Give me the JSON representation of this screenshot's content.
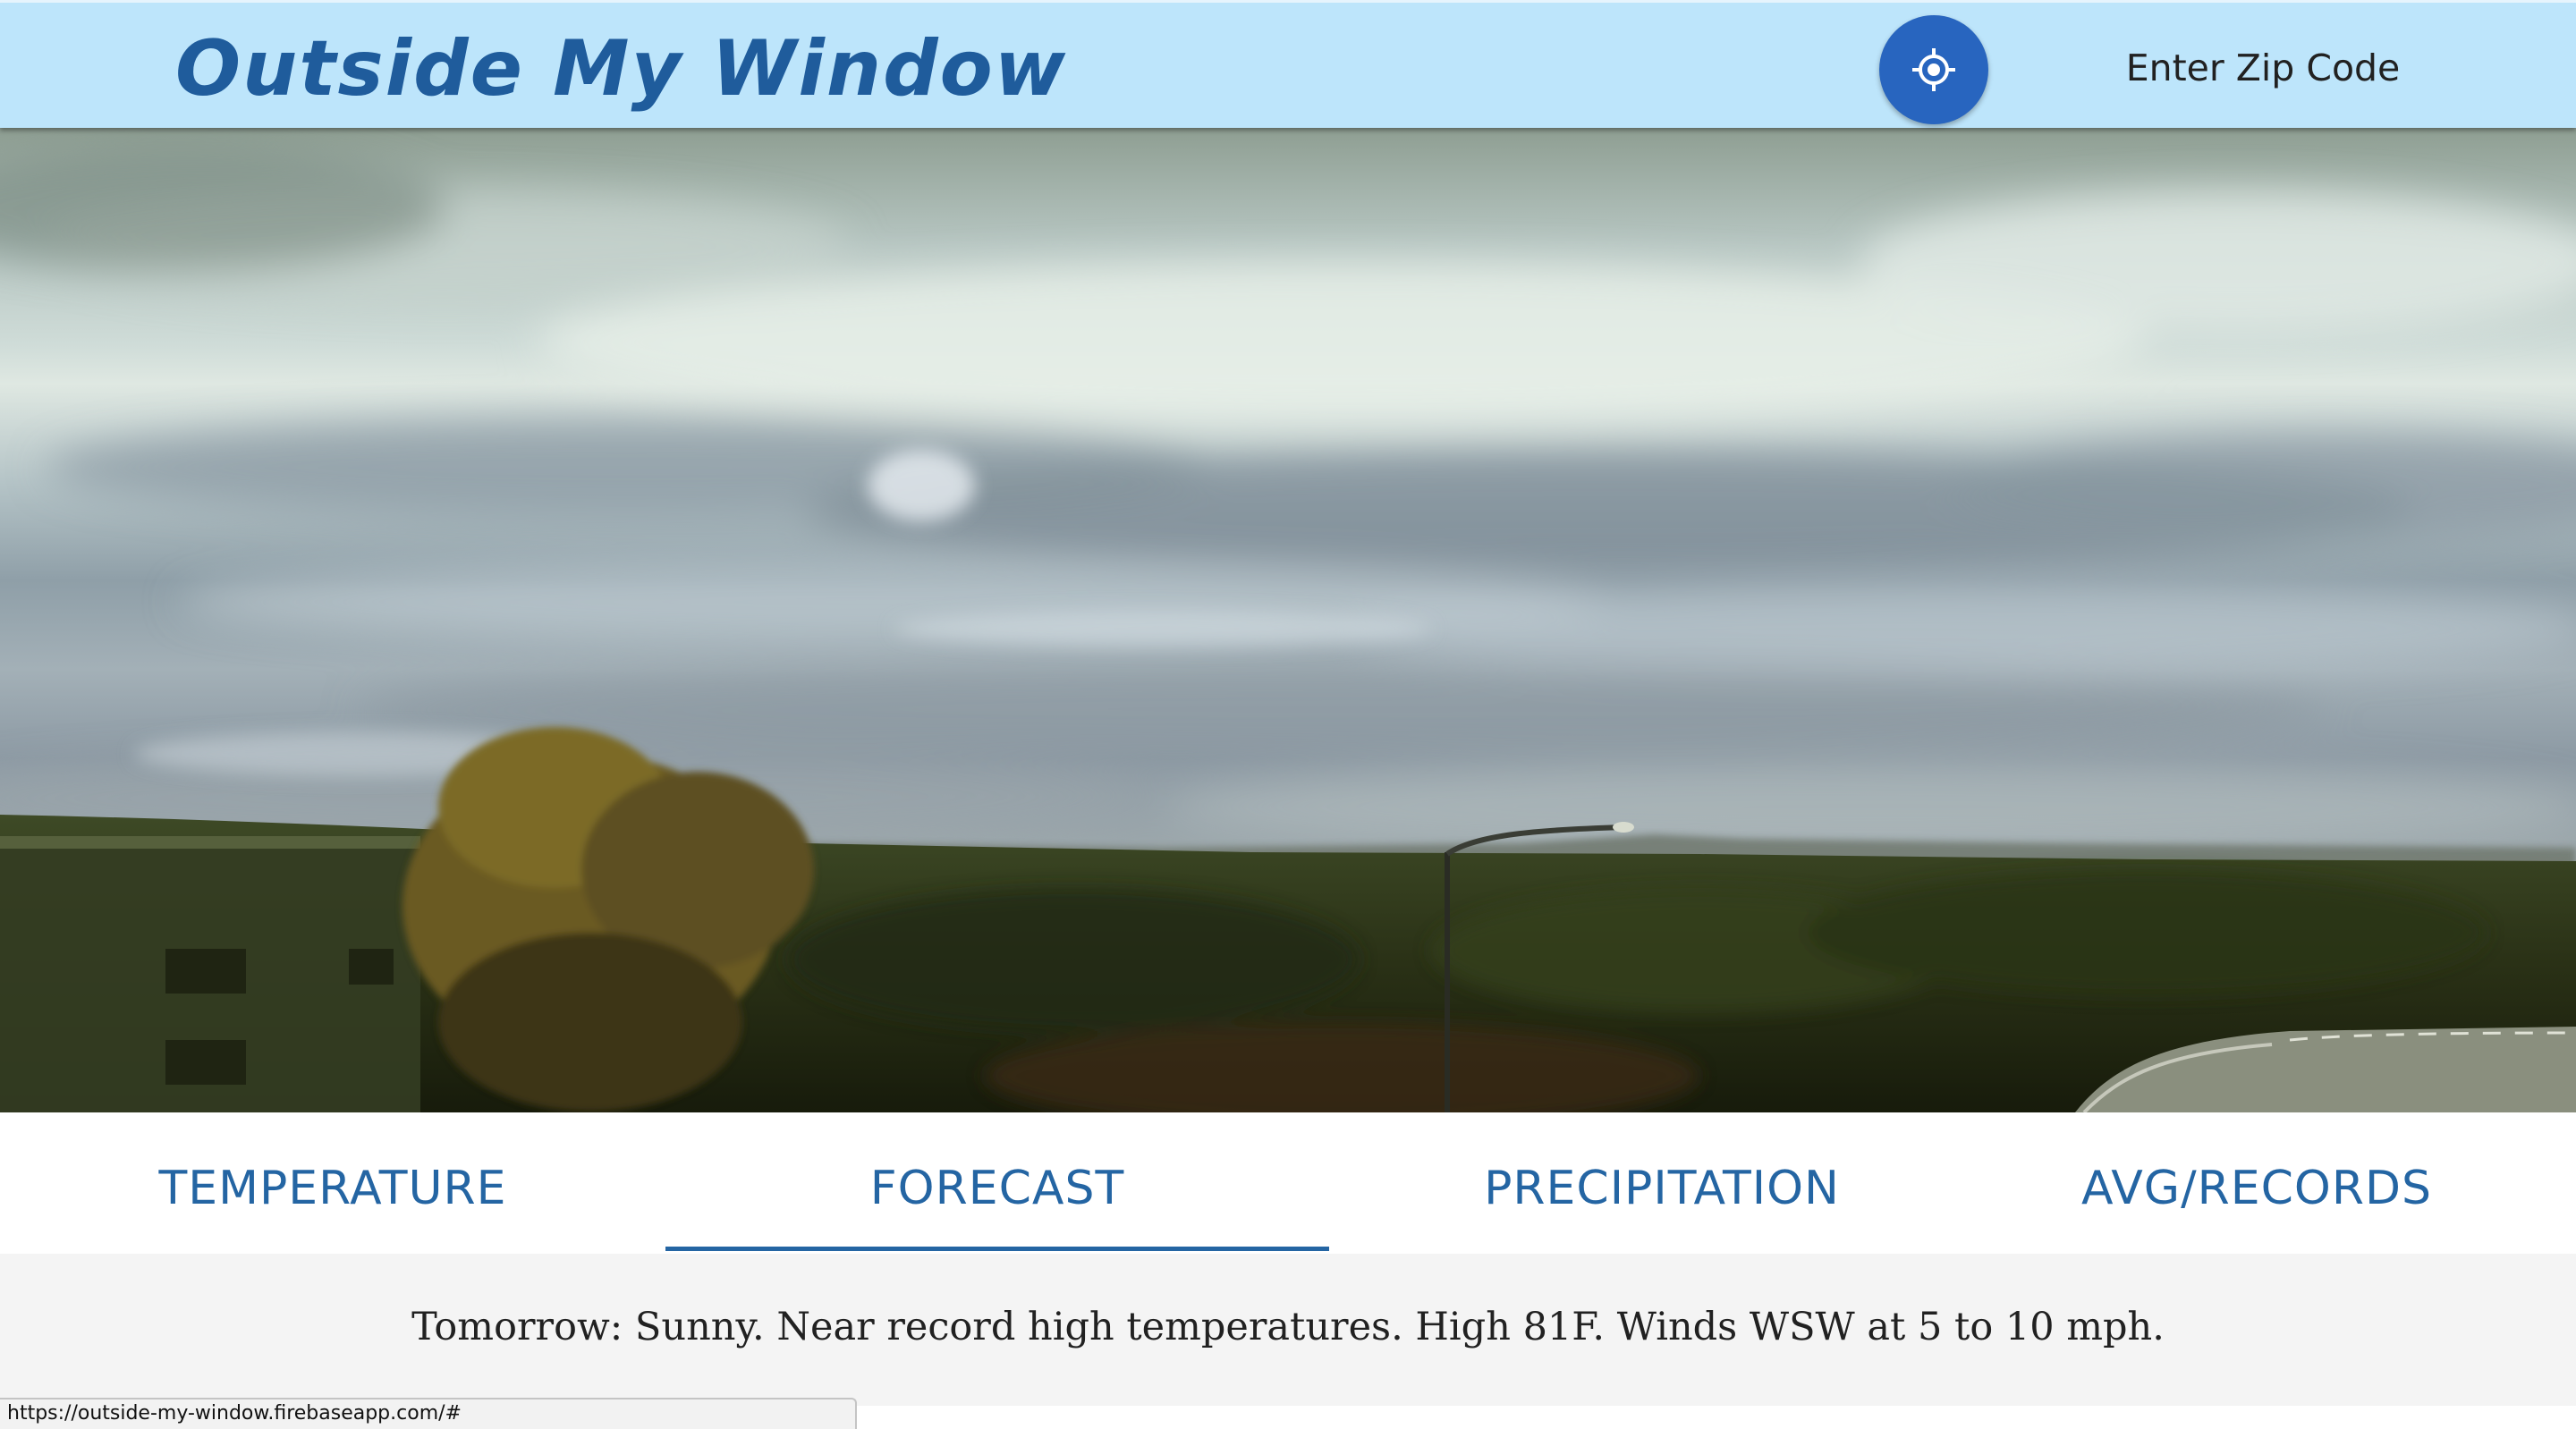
{
  "header": {
    "logo_text": "Outside My Window",
    "locate_icon": "crosshair-gps-icon",
    "zip_placeholder": "Enter Zip Code"
  },
  "webcam": {
    "description_icon": "webcam-image"
  },
  "tabs": [
    {
      "label": "TEMPERATURE",
      "active": false
    },
    {
      "label": "FORECAST",
      "active": true
    },
    {
      "label": "PRECIPITATION",
      "active": false
    },
    {
      "label": "AVG/RECORDS",
      "active": false
    }
  ],
  "forecast": {
    "text": "Tomorrow: Sunny. Near record high temperatures. High 81F. Winds WSW at 5 to 10 mph."
  },
  "status_bar": {
    "url": "https://outside-my-window.firebaseapp.com/#"
  },
  "colors": {
    "header_bg": "#bde5fb",
    "accent": "#2465a3",
    "locate_button": "#2865bf",
    "content_bg": "#f4f4f4"
  }
}
